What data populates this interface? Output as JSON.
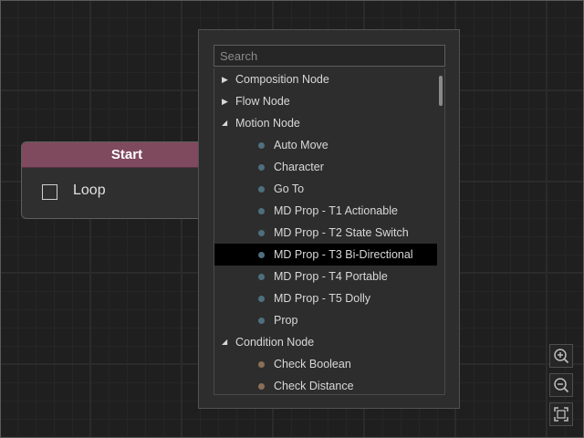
{
  "node": {
    "title": "Start",
    "checkbox_label": "Loop"
  },
  "popup": {
    "search_placeholder": "Search",
    "items": [
      {
        "label": "Composition Node",
        "kind": "category",
        "expanded": false
      },
      {
        "label": "Flow Node",
        "kind": "category",
        "expanded": false
      },
      {
        "label": "Motion Node",
        "kind": "category",
        "expanded": true
      },
      {
        "label": "Auto Move",
        "kind": "motion"
      },
      {
        "label": "Character",
        "kind": "motion"
      },
      {
        "label": "Go To",
        "kind": "motion"
      },
      {
        "label": "MD Prop - T1 Actionable",
        "kind": "motion"
      },
      {
        "label": "MD Prop - T2 State Switch",
        "kind": "motion"
      },
      {
        "label": "MD Prop - T3 Bi-Directional",
        "kind": "motion",
        "selected": true
      },
      {
        "label": "MD Prop - T4 Portable",
        "kind": "motion"
      },
      {
        "label": "MD Prop - T5 Dolly",
        "kind": "motion"
      },
      {
        "label": "Prop",
        "kind": "motion"
      },
      {
        "label": "Condition Node",
        "kind": "category",
        "expanded": true
      },
      {
        "label": "Check Boolean",
        "kind": "condition"
      },
      {
        "label": "Check Distance",
        "kind": "condition"
      }
    ]
  },
  "icons": {
    "collapsed": "triangle-right-icon",
    "expanded": "triangle-down-icon",
    "zoom_in": "zoom-in-icon",
    "zoom_out": "zoom-out-icon",
    "fit": "fit-view-icon"
  },
  "colors": {
    "node_header": "#7f4a5e",
    "motion_dot": "#4f6f7d",
    "condition_dot": "#8a6f57",
    "selected_row": "#000000"
  }
}
